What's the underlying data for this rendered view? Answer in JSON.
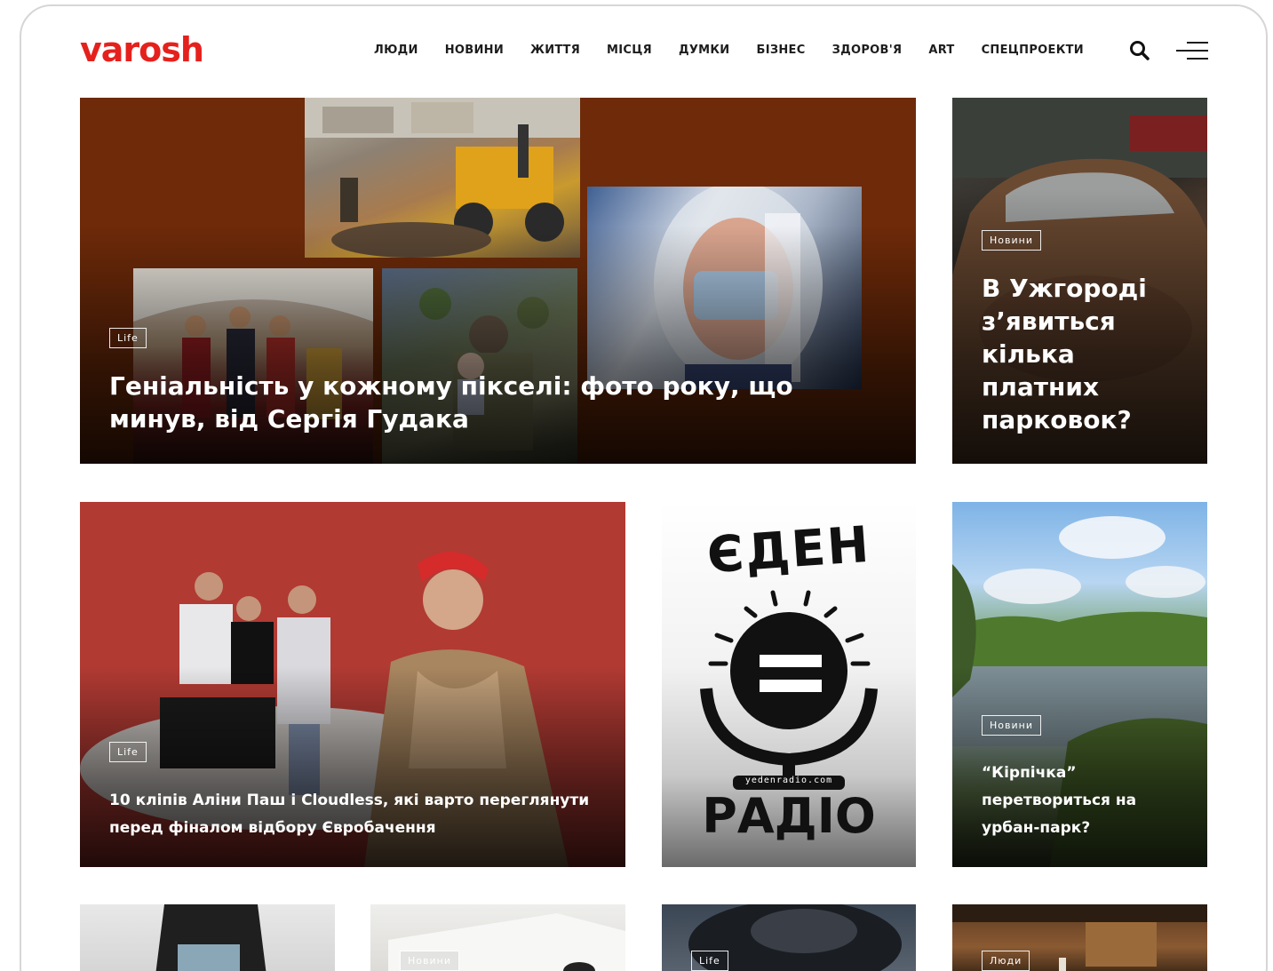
{
  "header": {
    "logo": "varosh",
    "nav": [
      "ЛЮДИ",
      "НОВИНИ",
      "ЖИТТЯ",
      "МІСЦЯ",
      "ДУМКИ",
      "БІЗНЕС",
      "ЗДОРОВ'Я",
      "ART",
      "СПЕЦПРОЕКТИ"
    ],
    "search_icon": "search-icon",
    "menu_icon": "hamburger-menu-icon"
  },
  "featured": [
    {
      "tag": "Life",
      "title": "Геніальність у кожному пікселі: фото року, що минув, від Сергія Гудака"
    },
    {
      "tag": "Новини",
      "title": "В Ужгороді з’явиться кілька платних парковок?"
    },
    {
      "tag": "Life",
      "title": "10 кліпів Аліни Паш і Cloudless, які варто переглянути перед фіналом відбору Євробачення"
    },
    {
      "logo_top": "ЄДЕН",
      "logo_url": "yedenradio.com",
      "logo_bottom": "РАДІО"
    },
    {
      "tag": "Новини",
      "title": "“Кірпічка” перетвориться на урбан-парк?"
    }
  ],
  "bottom_tags": [
    "",
    "Новини",
    "Life",
    "Люди"
  ],
  "colors": {
    "brand": "#e5211d",
    "text": "#1d1d1d"
  }
}
